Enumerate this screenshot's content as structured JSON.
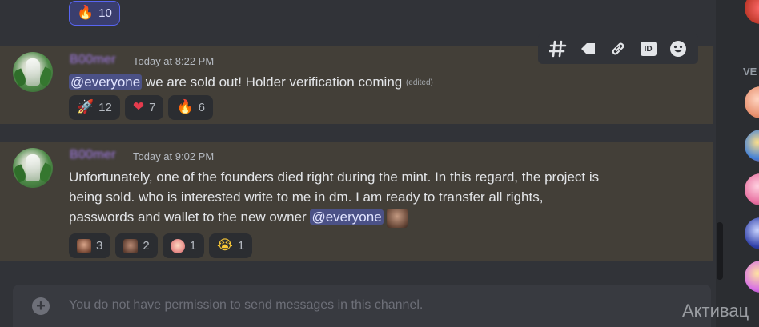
{
  "top_reaction": {
    "emoji": "🔥",
    "count": "10"
  },
  "messages": [
    {
      "username": "B00mer",
      "timestamp": "Today at 8:22 PM",
      "mention": "@everyone",
      "text": " we are sold out! Holder verification coming ",
      "edited": "(edited)",
      "reactions": [
        {
          "emoji": "🚀",
          "count": "12"
        },
        {
          "emoji": "❤",
          "count": "7"
        },
        {
          "emoji": "🔥",
          "count": "6"
        }
      ]
    },
    {
      "username": "B00mer",
      "timestamp": "Today at 9:02 PM",
      "line1": "Unfortunately, one of the founders died right during the mint. In this regard, the project is",
      "line2": "being sold. who is interested write to me in dm. I am ready to transfer all rights,",
      "line3": "passwords and wallet to the new owner ",
      "mention": "@everyone",
      "reactions": [
        {
          "emoji": "face-1",
          "count": "3"
        },
        {
          "emoji": "face-2",
          "count": "2"
        },
        {
          "emoji": "face-3",
          "count": "1"
        },
        {
          "emoji": "😭",
          "count": "1"
        }
      ]
    }
  ],
  "toolbar": {
    "icons": [
      "thread-icon",
      "tag-icon",
      "link-icon",
      "id-icon",
      "emoji-icon"
    ],
    "id_label": "ID"
  },
  "input": {
    "placeholder": "You do not have permission to send messages in this channel."
  },
  "members": {
    "section_label": "VE"
  },
  "watermark": "Активац"
}
